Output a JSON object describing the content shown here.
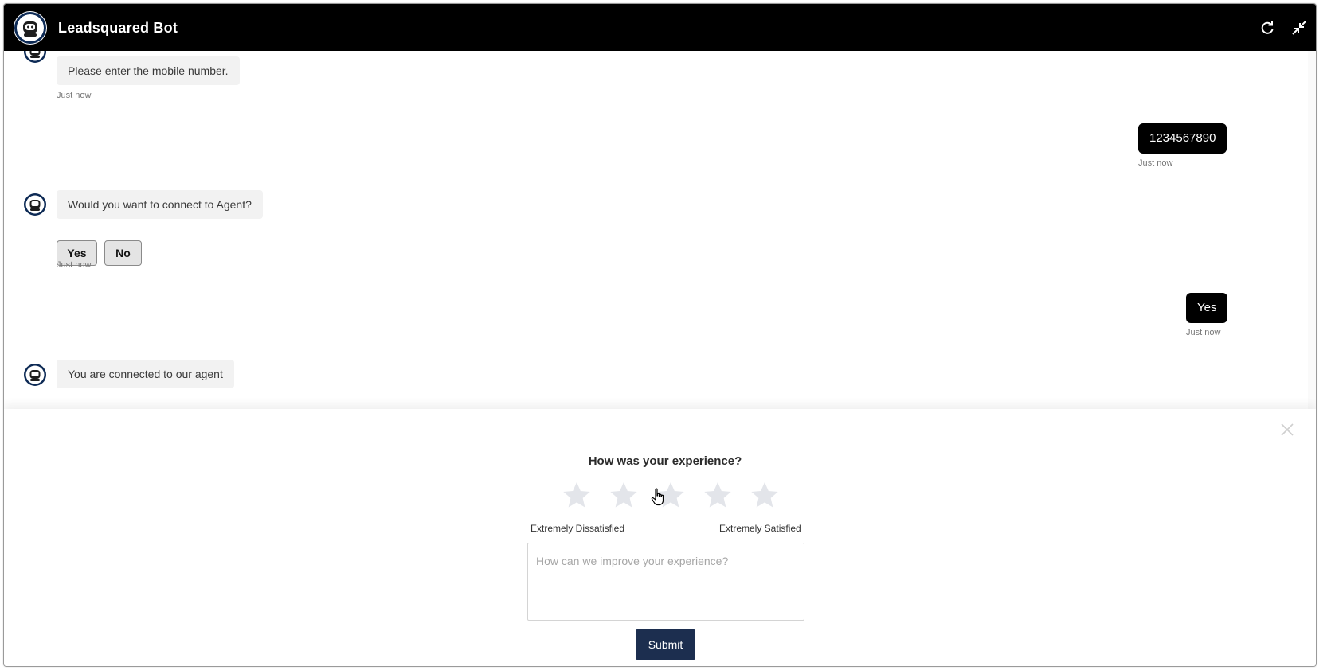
{
  "header": {
    "title": "Leadsquared Bot",
    "bg_color": "#000000",
    "refresh_icon": "refresh-icon",
    "minimize_icon": "minimize-icon"
  },
  "chat": {
    "messages": [
      {
        "from": "bot",
        "text": "Please enter the mobile number.",
        "time": "Just now"
      },
      {
        "from": "user",
        "text": "1234567890",
        "time": "Just now"
      },
      {
        "from": "bot",
        "text": "Would you want to connect to Agent?",
        "time": "Just now",
        "options": [
          "Yes",
          "No"
        ]
      },
      {
        "from": "user",
        "text": "Yes",
        "time": "Just now"
      },
      {
        "from": "bot",
        "text": "You are connected to our agent"
      }
    ],
    "bot_avatar_icon": "robot-icon"
  },
  "feedback": {
    "title": "How was your experience?",
    "rating_max": 5,
    "rating_value": 0,
    "low_label": "Extremely Dissatisfied",
    "high_label": "Extremely Satisfied",
    "comment_placeholder": "How can we improve your experience?",
    "submit_label": "Submit",
    "close_icon": "close-icon",
    "star_color": "#e3e5ea",
    "submit_color": "#1c2e4f"
  }
}
